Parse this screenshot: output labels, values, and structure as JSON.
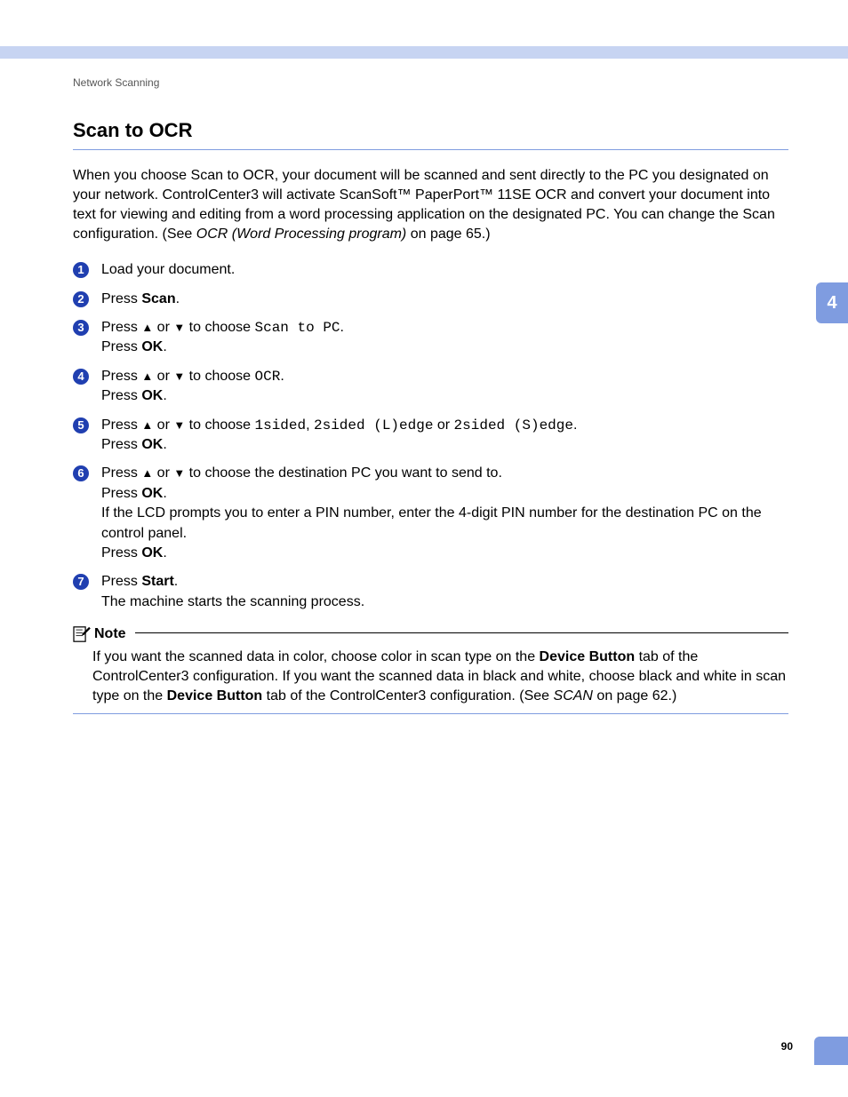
{
  "header": {
    "breadcrumb": "Network Scanning"
  },
  "side_tab": "4",
  "title": "Scan to OCR",
  "intro": {
    "pre": "When you choose Scan to OCR, your document will be scanned and sent directly to the PC you designated on your network. ControlCenter3 will activate ScanSoft™ PaperPort™ 11SE OCR and convert your document into text for viewing and editing from a word processing application on the designated PC. You can change the Scan configuration. (See ",
    "italic": "OCR (Word Processing program)",
    "post": " on page 65.)"
  },
  "steps": {
    "s1": "Load your document.",
    "s2": {
      "a": "Press ",
      "b": "Scan",
      "c": "."
    },
    "s3": {
      "a": "Press ",
      "up": "▲",
      "or": " or ",
      "down": "▼",
      "b": " to choose ",
      "mono": "Scan to PC",
      "c": ".",
      "d": "Press ",
      "ok": "OK",
      "e": "."
    },
    "s4": {
      "a": "Press ",
      "up": "▲",
      "or": " or ",
      "down": "▼",
      "b": " to choose ",
      "mono": "OCR",
      "c": ".",
      "d": "Press ",
      "ok": "OK",
      "e": "."
    },
    "s5": {
      "a": "Press ",
      "up": "▲",
      "or": " or ",
      "down": "▼",
      "b": " to choose ",
      "m1": "1sided",
      "comma": ", ",
      "m2": "2sided (L)edge",
      "or2": " or ",
      "m3": "2sided (S)edge",
      "c": ".",
      "d": "Press ",
      "ok": "OK",
      "e": "."
    },
    "s6": {
      "a": "Press ",
      "up": "▲",
      "or": " or ",
      "down": "▼",
      "b": " to choose the destination PC you want to send to.",
      "c": "Press ",
      "ok": "OK",
      "d": ".",
      "e": "If the LCD prompts you to enter a PIN number, enter the 4-digit PIN number for the destination PC on the control panel.",
      "f": "Press ",
      "ok2": "OK",
      "g": "."
    },
    "s7": {
      "a": "Press ",
      "b": "Start",
      "c": ".",
      "d": "The machine starts the scanning process."
    }
  },
  "note": {
    "label": "Note",
    "t1": "If you want the scanned data in color, choose color in scan type on the ",
    "b1": "Device Button",
    "t2": " tab of the ControlCenter3 configuration. If you want the scanned data in black and white, choose black and white in scan type on the ",
    "b2": "Device Button",
    "t3": " tab of the ControlCenter3 configuration. (See ",
    "italic": "SCAN",
    "t4": " on page 62.)"
  },
  "page_number": "90"
}
